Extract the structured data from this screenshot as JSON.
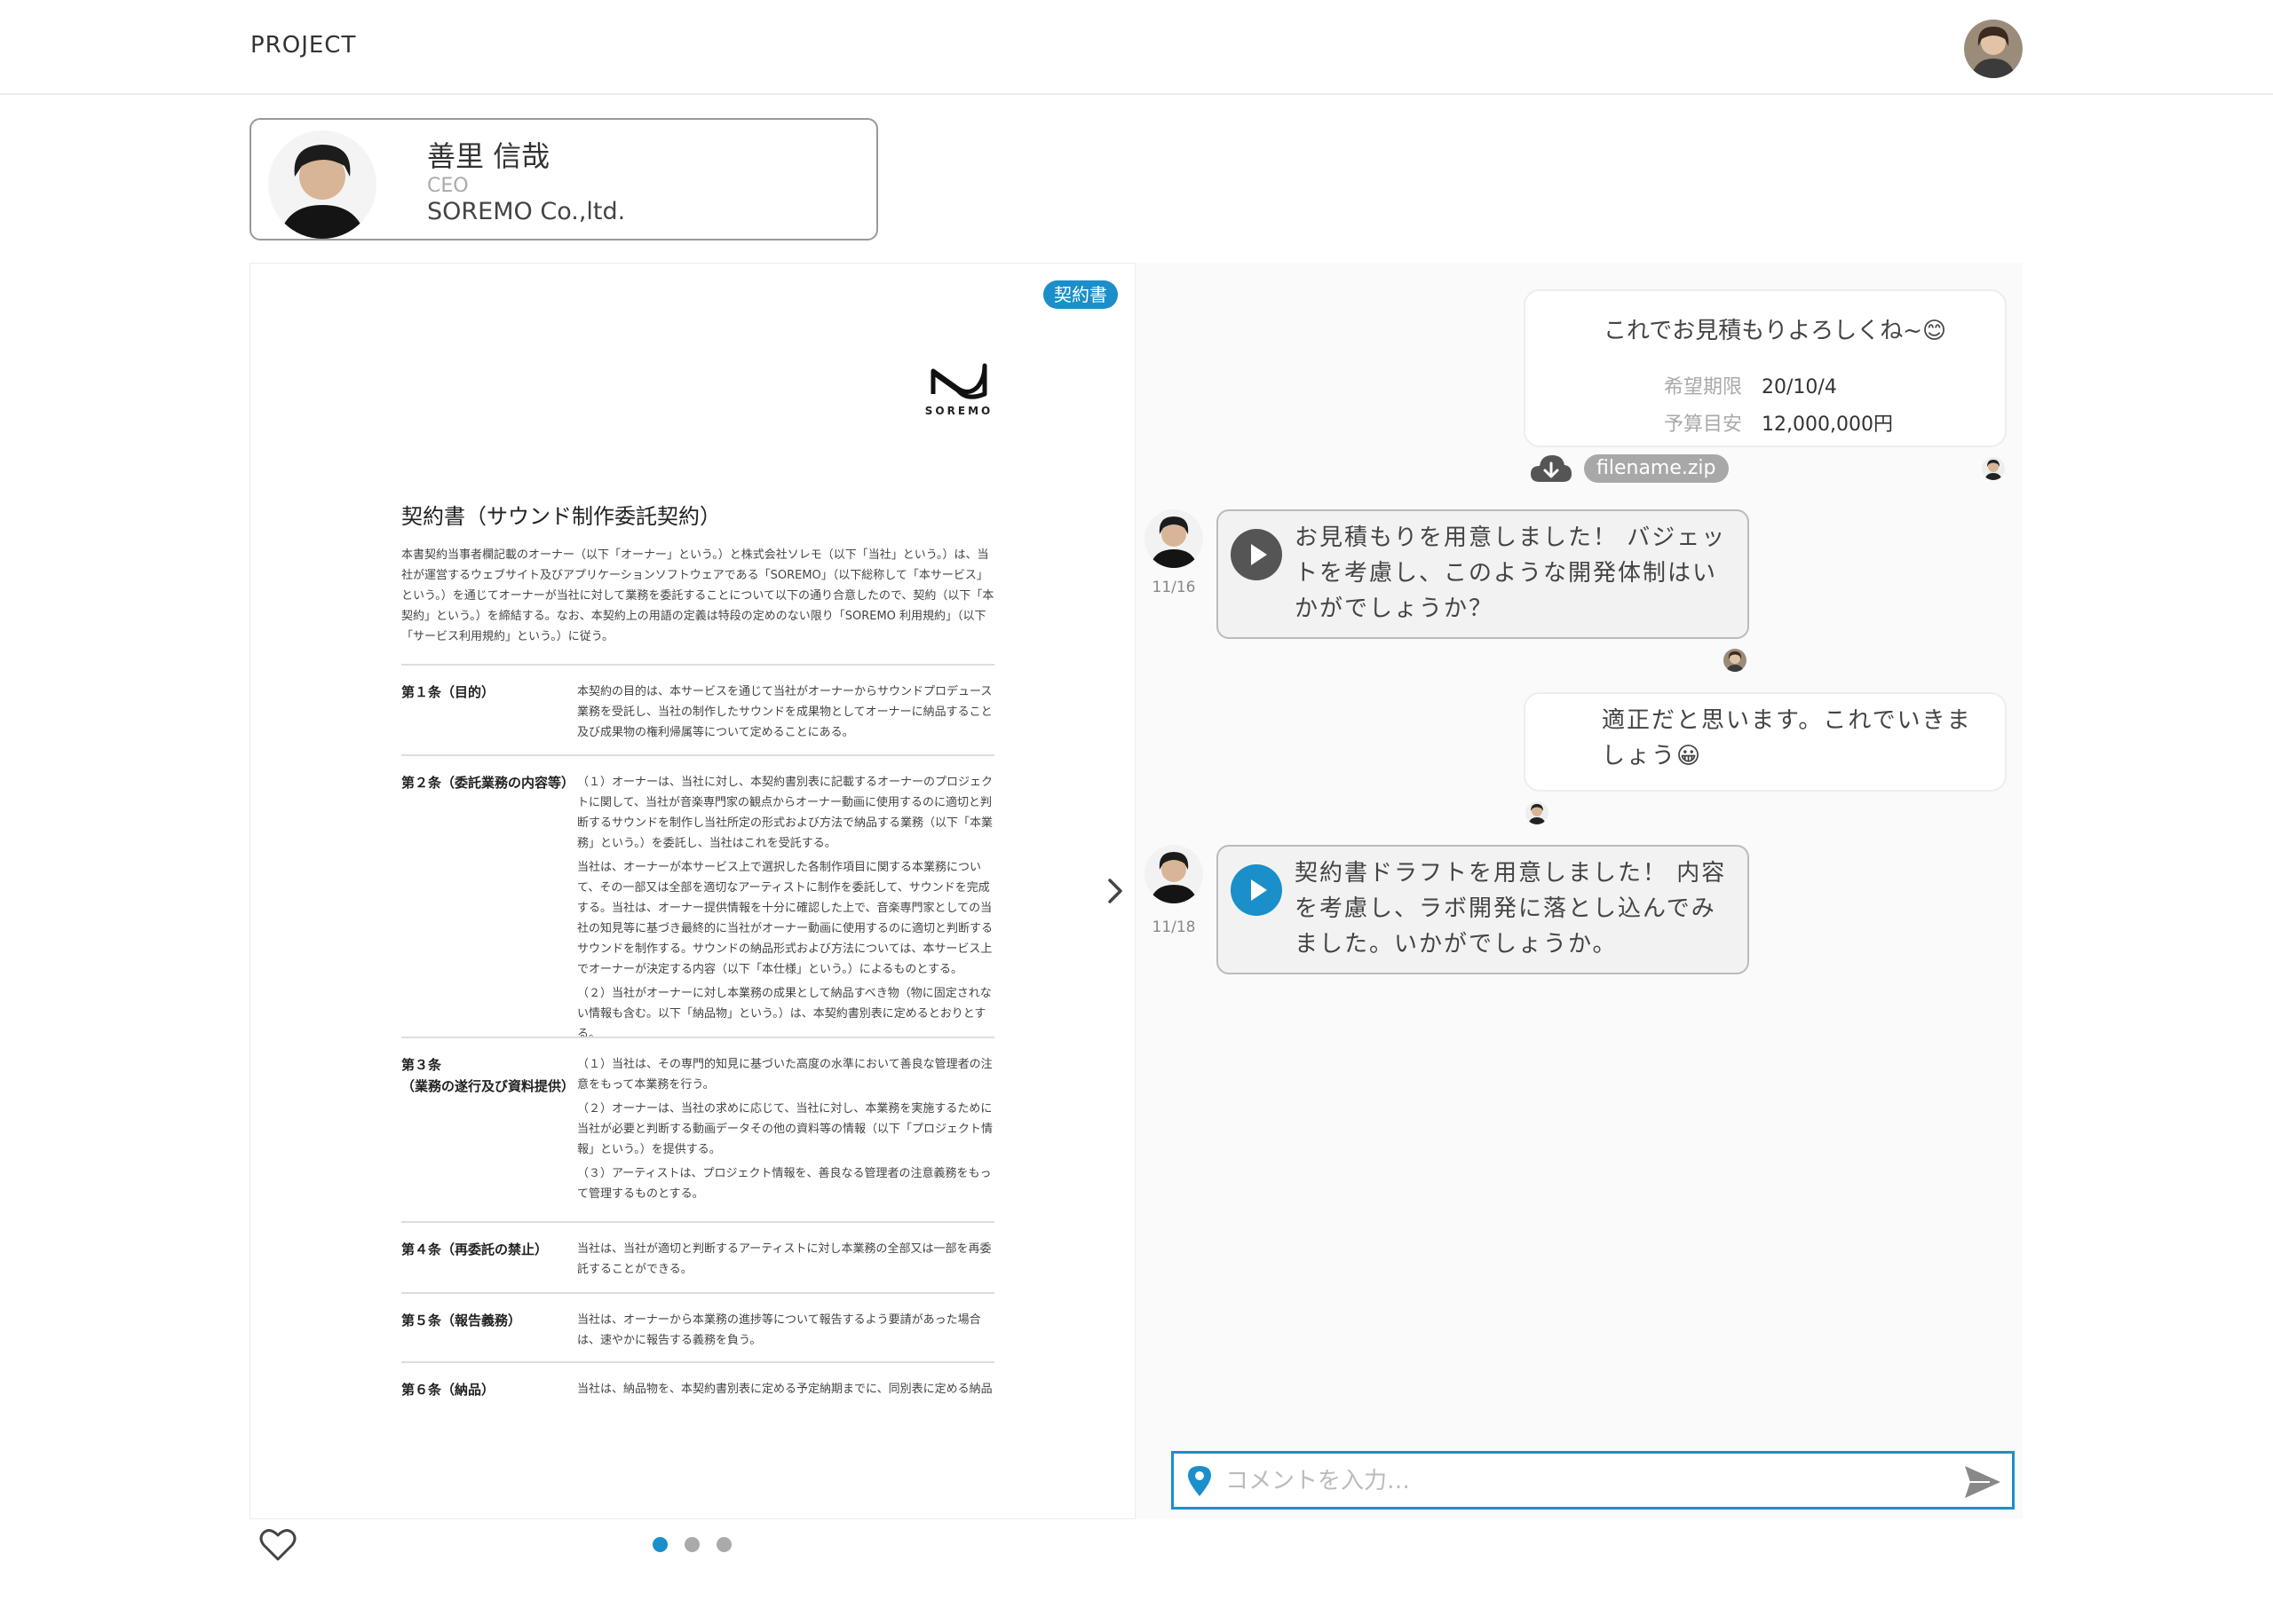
{
  "header": {
    "title": "PROJECT"
  },
  "profile": {
    "name": "善里 信哉",
    "role": "CEO",
    "company": "SOREMO Co.,ltd."
  },
  "document": {
    "badge": "契約書",
    "logo_text": "SOREMO",
    "title": "契約書（サウンド制作委託契約）",
    "intro": "本書契約当事者欄記載のオーナー（以下「オーナー」という。）と株式会社ソレモ（以下「当社」という。）は、当社が運営するウェブサイト及びアプリケーションソフトウェアである「SOREMO」（以下総称して「本サービス」という。）を通じてオーナーが当社に対して業務を委託することについて以下の通り合意したので、契約（以下「本契約」という。）を締結する。なお、本契約上の用語の定義は特段の定めのない限り「SOREMO 利用規約」（以下「サービス利用規約」という。）に従う。",
    "articles": [
      {
        "heading": "第１条（目的）",
        "body": [
          "本契約の目的は、本サービスを通じて当社がオーナーからサウンドプロデュース業務を受託し、当社の制作したサウンドを成果物としてオーナーに納品すること及び成果物の権利帰属等について定めることにある。"
        ]
      },
      {
        "heading": "第２条（委託業務の内容等）",
        "body": [
          "（１）オーナーは、当社に対し、本契約書別表に記載するオーナーのプロジェクトに関して、当社が音楽専門家の観点からオーナー動画に使用するのに適切と判断するサウンドを制作し当社所定の形式および方法で納品する業務（以下「本業務」という。）を委託し、当社はこれを受託する。",
          "当社は、オーナーが本サービス上で選択した各制作項目に関する本業務について、その一部又は全部を適切なアーティストに制作を委託して、サウンドを完成する。当社は、オーナー提供情報を十分に確認した上で、音楽専門家としての当社の知見等に基づき最終的に当社がオーナー動画に使用するのに適切と判断するサウンドを制作する。サウンドの納品形式および方法については、本サービス上でオーナーが決定する内容（以下「本仕様」という。）によるものとする。",
          "（２）当社がオーナーに対し本業務の成果として納品すべき物（物に固定されない情報も含む。以下「納品物」という。）は、本契約書別表に定めるとおりとする。"
        ]
      },
      {
        "heading": "第３条\n（業務の遂行及び資料提供）",
        "body": [
          "（１）当社は、その専門的知見に基づいた高度の水準において善良な管理者の注意をもって本業務を行う。",
          "（２）オーナーは、当社の求めに応じて、当社に対し、本業務を実施するために当社が必要と判断する動画データその他の資料等の情報（以下「プロジェクト情報」という。）を提供する。",
          "（３）アーティストは、プロジェクト情報を、善良なる管理者の注意義務をもって管理するものとする。"
        ]
      },
      {
        "heading": "第４条（再委託の禁止）",
        "body": [
          "当社は、当社が適切と判断するアーティストに対し本業務の全部又は一部を再委託することができる。"
        ]
      },
      {
        "heading": "第５条（報告義務）",
        "body": [
          "当社は、オーナーから本業務の進捗等について報告するよう要請があった場合は、速やかに報告する義務を負う。"
        ]
      },
      {
        "heading": "第６条（納品）",
        "body": [
          "当社は、納品物を、本契約書別表に定める予定納期までに、同別表に定める納品"
        ]
      }
    ]
  },
  "chat": {
    "messages": [
      {
        "side": "right",
        "text": "これでお見積もりよろしくね~😊",
        "meta": [
          {
            "label": "希望期限",
            "value": "20/10/4"
          },
          {
            "label": "予算目安",
            "value": "12,000,000円"
          }
        ],
        "file": "filename.zip"
      },
      {
        "side": "left",
        "date": "11/16",
        "text": "お見積もりを用意しました！ バジェットを考慮し、このような開発体制はいかがでしょうか？",
        "play_color": "#555555"
      },
      {
        "side": "right",
        "text": "適正だと思います。これでいきましょう😀"
      },
      {
        "side": "left",
        "date": "11/18",
        "text": "契約書ドラフトを用意しました！ 内容を考慮し、ラボ開発に落とし込んでみました。いかがでしょうか。",
        "play_color": "#1a8fc9"
      }
    ]
  },
  "comment": {
    "placeholder": "コメントを入力…"
  },
  "pagination": {
    "pages": 3,
    "current": 1
  },
  "colors": {
    "accent": "#1a8fc9",
    "border": "#999999",
    "chip": "#a8a8a8"
  },
  "icons": [
    "heart-icon",
    "chevron-right-icon",
    "cloud-download-icon",
    "play-icon",
    "map-pin-icon",
    "send-icon"
  ]
}
